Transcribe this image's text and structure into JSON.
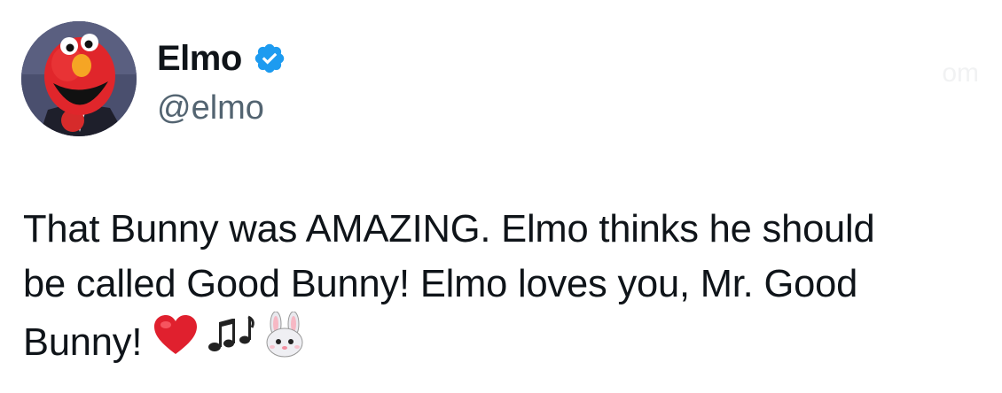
{
  "user": {
    "display_name": "Elmo",
    "handle": "@elmo",
    "verified": true,
    "verified_color": "#1d9bf0",
    "avatar_icon": "elmo-avatar"
  },
  "tweet": {
    "line1": "That Bunny was AMAZING. Elmo thinks he should",
    "line2": "be called Good Bunny! Elmo loves you, Mr. Good",
    "line3": "Bunny!",
    "emojis": [
      "red-heart-icon",
      "musical-notes-icon",
      "rabbit-face-icon"
    ]
  },
  "watermark": "om"
}
